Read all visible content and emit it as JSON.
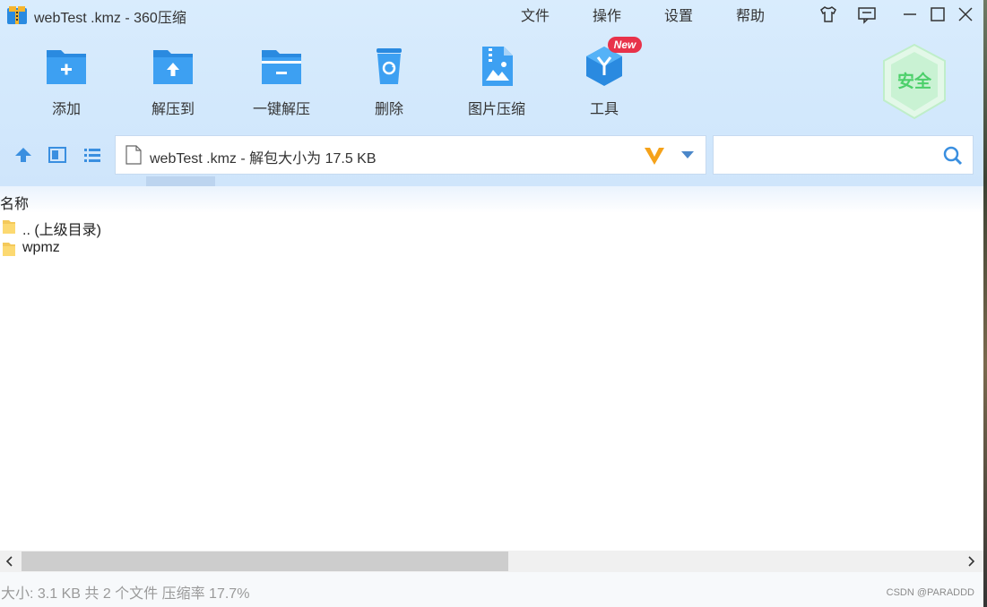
{
  "window": {
    "title": "webTest .kmz - 360压缩"
  },
  "menu": [
    "文件",
    "操作",
    "设置",
    "帮助"
  ],
  "title_buttons": [
    "skin-icon",
    "feedback-icon",
    "minimize-icon",
    "maximize-icon",
    "close-icon"
  ],
  "toolbar": {
    "items": [
      {
        "label": "添加",
        "icon": "add-folder-icon"
      },
      {
        "label": "解压到",
        "icon": "extract-to-icon"
      },
      {
        "label": "一键解压",
        "icon": "one-click-extract-icon"
      },
      {
        "label": "删除",
        "icon": "recycle-bin-icon"
      },
      {
        "label": "图片压缩",
        "icon": "image-compress-icon"
      },
      {
        "label": "工具",
        "icon": "tools-icon"
      }
    ],
    "new_badge": "New",
    "safe_badge": "安全"
  },
  "address": {
    "text": "webTest .kmz - 解包大小为 17.5 KB"
  },
  "search": {
    "placeholder": ""
  },
  "list": {
    "column_name": "名称",
    "rows": [
      {
        "name": ".. (上级目录)"
      },
      {
        "name": "wpmz"
      }
    ]
  },
  "status": {
    "text": "大小: 3.1 KB 共 2 个文件 压缩率 17.7%",
    "watermark": "CSDN @PARADDD"
  },
  "colors": {
    "accent": "#2a8ae0",
    "header_bg": "#d4e9fc",
    "safe_green": "#4cd06a",
    "new_red": "#e8324a"
  }
}
